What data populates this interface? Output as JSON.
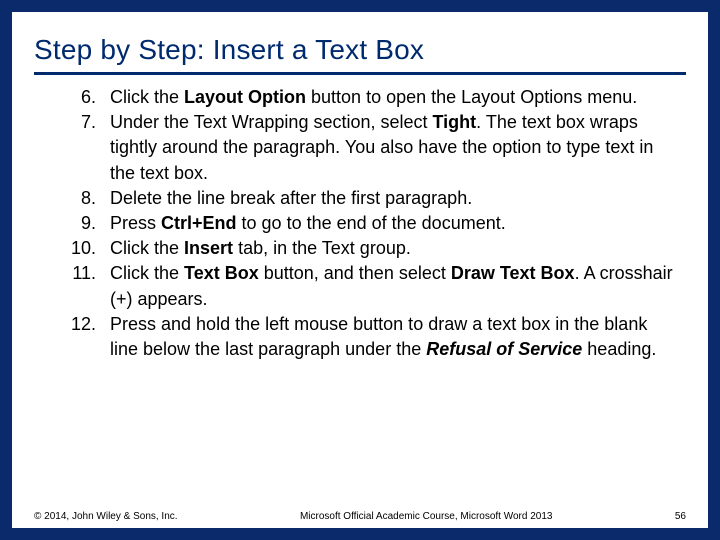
{
  "title": "Step by Step: Insert a Text Box",
  "steps": [
    {
      "num": "6.",
      "parts": [
        "Click the ",
        {
          "b": "Layout Option"
        },
        " button to open the Layout Options menu."
      ]
    },
    {
      "num": "7.",
      "parts": [
        "Under the Text Wrapping section, select ",
        {
          "b": "Tight"
        },
        ". The text box wraps tightly around the paragraph. You also have the option to type text in the text box."
      ]
    },
    {
      "num": "8.",
      "parts": [
        "Delete the line break after the first paragraph."
      ]
    },
    {
      "num": "9.",
      "parts": [
        "Press ",
        {
          "b": "Ctrl+End"
        },
        " to go to the end of the document."
      ]
    },
    {
      "num": "10.",
      "parts": [
        "Click the ",
        {
          "b": "Insert"
        },
        " tab, in the Text group."
      ]
    },
    {
      "num": "11.",
      "parts": [
        "Click the ",
        {
          "b": "Text Box"
        },
        " button, and then select ",
        {
          "b": "Draw Text Box"
        },
        ". A crosshair (+) appears."
      ]
    },
    {
      "num": "12.",
      "parts": [
        "Press and hold the left mouse button to draw a text box in the blank line below the last paragraph under the ",
        {
          "bi": "Refusal of Service"
        },
        " heading."
      ]
    }
  ],
  "footer": {
    "left": "© 2014, John Wiley & Sons, Inc.",
    "center": "Microsoft Official Academic Course, Microsoft Word 2013",
    "right": "56"
  }
}
